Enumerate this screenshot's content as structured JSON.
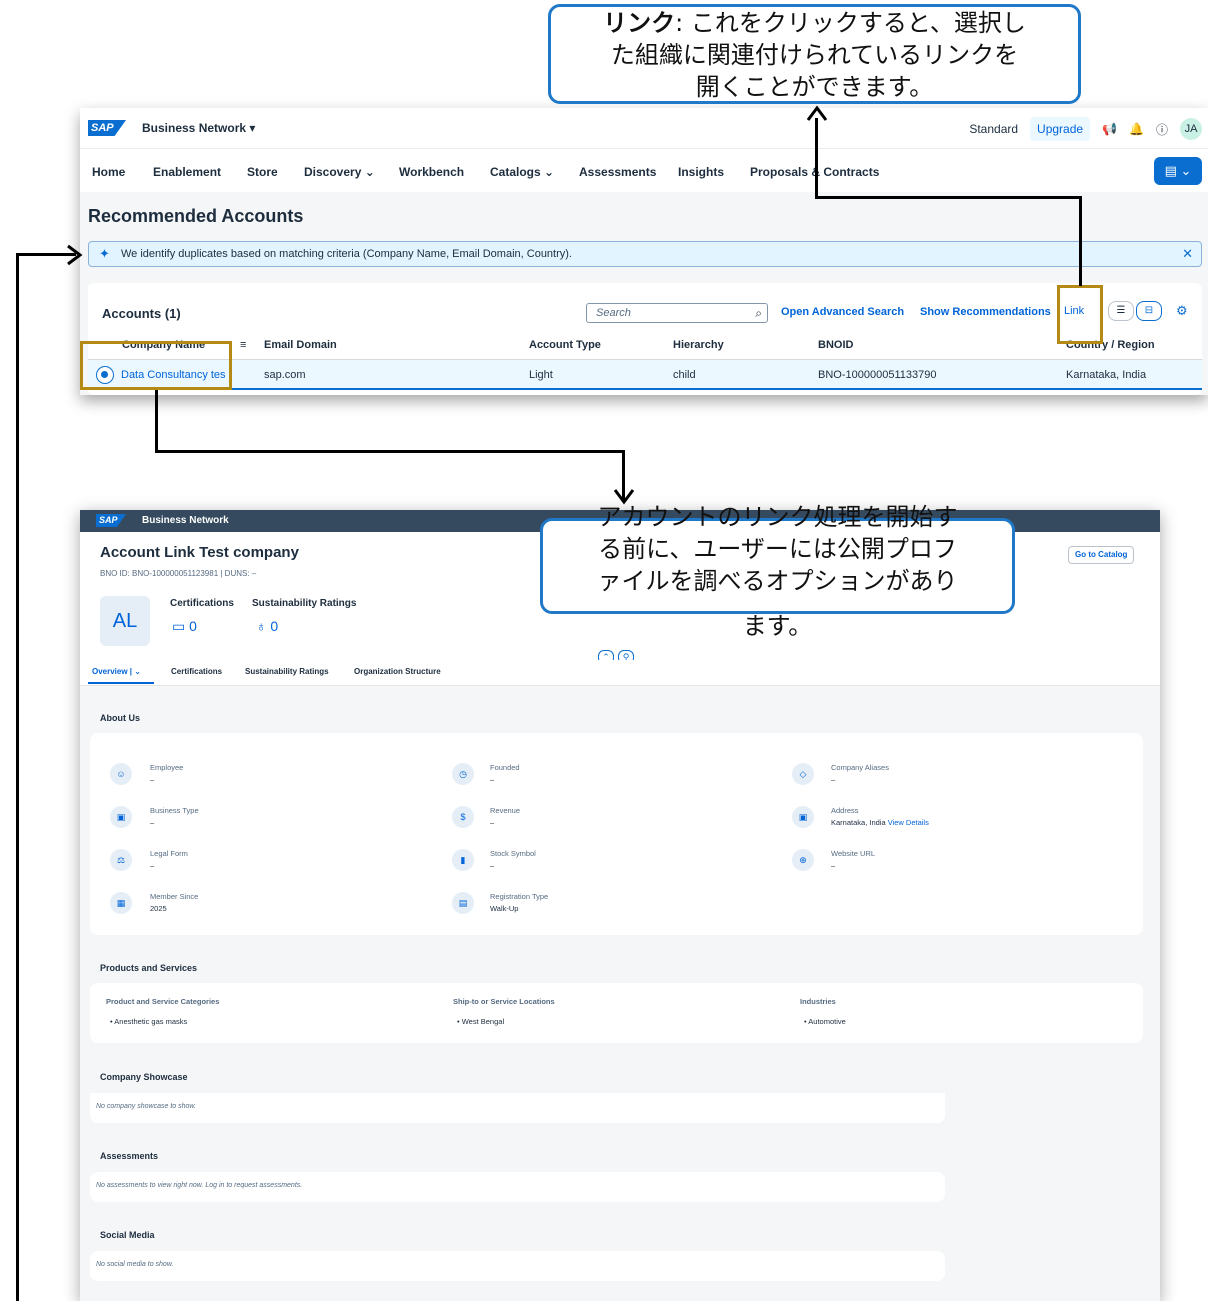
{
  "callouts": {
    "link": {
      "bold": "リンク",
      "line1_rest": ": これをクリックすると、選択し",
      "line2": "た組織に関連付けられているリンクを",
      "line3": "開くことができます。"
    },
    "profile": {
      "line1": "アカウントのリンク処理を開始す",
      "line2": "る前に、ユーザーには公開プロフ",
      "line3": "ァイルを調べるオプションがあり",
      "line4": "ます。"
    }
  },
  "shell": {
    "product": "Business Network",
    "standard": "Standard",
    "upgrade": "Upgrade",
    "avatar": "JA"
  },
  "nav": {
    "items": [
      "Home",
      "Enablement",
      "Store",
      "Discovery ⌄",
      "Workbench",
      "Catalogs ⌄",
      "Assessments",
      "Insights",
      "Proposals & Contracts"
    ]
  },
  "page": {
    "title": "Recommended Accounts",
    "info": "We identify duplicates based on matching criteria (Company Name, Email Domain, Country)."
  },
  "accounts": {
    "title": "Accounts (1)",
    "search_placeholder": "Search",
    "open_advanced_search": "Open Advanced Search",
    "show_recommendations": "Show Recommendations",
    "link": "Link",
    "columns": [
      "Company Name",
      "Email Domain",
      "Account Type",
      "Hierarchy",
      "BNOID",
      "Country / Region"
    ],
    "rows": [
      {
        "company": "Data Consultancy tes",
        "email_domain": "sap.com",
        "account_type": "Light",
        "hierarchy": "child",
        "bnoid": "BNO-100000051133790",
        "country": "Karnataka, India"
      }
    ]
  },
  "profile": {
    "product": "Business Network",
    "company_name": "Account Link Test company",
    "ids": "BNO ID: BNO-100000051123981  |  DUNS: –",
    "go_to_catalog": "Go to Catalog",
    "avatar": "AL",
    "certifications_label": "Certifications",
    "certifications_value": "0",
    "sustainability_label": "Sustainability Ratings",
    "sustainability_value": "0",
    "tabs": [
      "Overview",
      "Certifications",
      "Sustainability Ratings",
      "Organization Structure"
    ],
    "about_title": "About Us",
    "facts": [
      {
        "label": "Employee",
        "value": "–"
      },
      {
        "label": "Founded",
        "value": "–"
      },
      {
        "label": "Company Aliases",
        "value": "–"
      },
      {
        "label": "Business Type",
        "value": "–"
      },
      {
        "label": "Revenue",
        "value": "–"
      },
      {
        "label": "Address",
        "value": "Karnataka, India",
        "link": "View Details"
      },
      {
        "label": "Legal Form",
        "value": "–"
      },
      {
        "label": "Stock Symbol",
        "value": "–"
      },
      {
        "label": "Website URL",
        "value": "–"
      },
      {
        "label": "Member Since",
        "value": "2025"
      },
      {
        "label": "Registration Type",
        "value": "Walk-Up"
      }
    ],
    "products_title": "Products and Services",
    "product_categories_label": "Product and Service Categories",
    "product_categories": [
      "Anesthetic gas masks"
    ],
    "ship_to_label": "Ship-to or Service Locations",
    "ship_to": [
      "West Bengal"
    ],
    "industries_label": "Industries",
    "industries": [
      "Automotive"
    ],
    "showcase_title": "Company Showcase",
    "showcase_empty": "No company showcase to show.",
    "assessments_title": "Assessments",
    "assessments_empty": "No assessments to view right now. Log in to request assessments.",
    "social_title": "Social Media",
    "social_empty": "No social media to show."
  }
}
